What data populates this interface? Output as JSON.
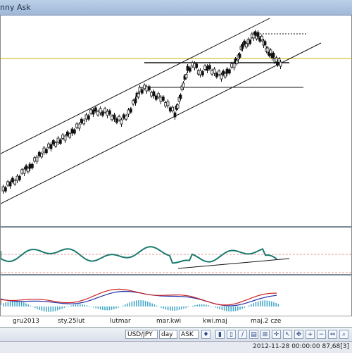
{
  "window": {
    "title": "nny Ask"
  },
  "xaxis": {
    "labels": [
      "gru2013",
      "sty.25lut",
      "lutmar",
      "mar.kwi",
      "kwi.maj",
      "maj.2 cze"
    ]
  },
  "toolbar": {
    "symbol": "USD/JPY",
    "timeframe": "day",
    "price_type": "ASK",
    "icons": [
      "chart-icon",
      "bar-icon",
      "line-icon",
      "candle-icon",
      "zoom-icon",
      "cursor-icon",
      "crosshair-icon",
      "arrow-icon",
      "pan-icon",
      "zoom-in-icon",
      "zoom-out-icon",
      "fit-icon",
      "pin-icon",
      "lock-icon",
      "period-icon"
    ]
  },
  "status": {
    "text": "2012-11-28 00:00:00  87,68[3]"
  },
  "colors": {
    "price_line": "#c8b400",
    "rsi": "#1a7a6e",
    "macd_red": "#cc2222",
    "macd_blue": "#2233aa"
  }
}
